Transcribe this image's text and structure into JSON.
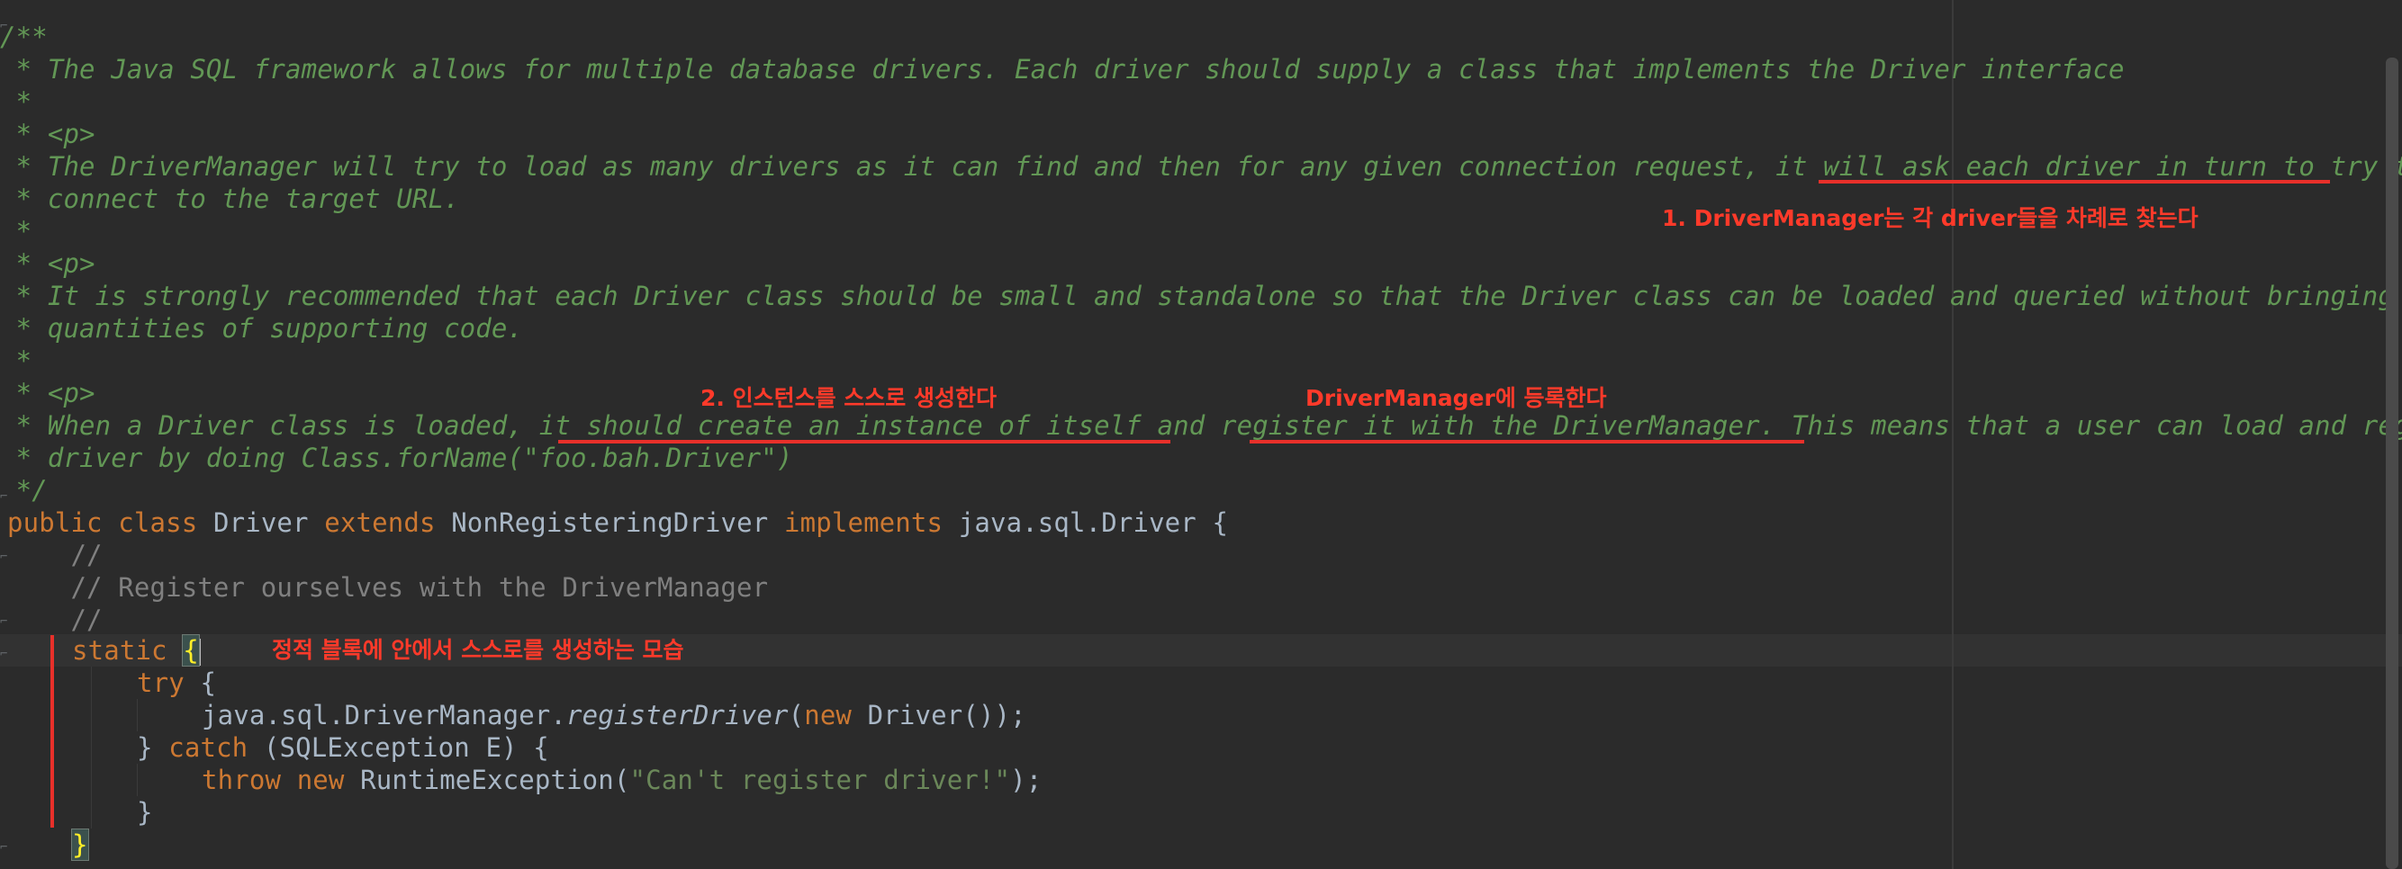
{
  "code": {
    "l1": "/**",
    "l2": " * The Java SQL framework allows for multiple database drivers. Each driver should supply a class that implements the Driver interface",
    "l3": " *",
    "l4": " * <p>",
    "l5a": " * The DriverManager will try to load as many drivers as it can find and then for any given connection request, ",
    "l5b": "it will ask each driver in turn",
    "l5c": " to try to",
    "l6": " * connect to the target URL.",
    "l7": " *",
    "l8": " * <p>",
    "l9": " * It is strongly recommended that each Driver class should be small and standalone so that the Driver class can be loaded and queried without bringing in vast",
    "l10": " * quantities of supporting code.",
    "l11": " *",
    "l12": " * <p>",
    "l13a": " * When a Driver class is loaded, ",
    "l13b": "it should create an instance of itself",
    "l13c": " and ",
    "l13d": "register it with the DriverManager",
    "l13e": ". This means that a user can load and register a",
    "l14a": " * driver by doing Class.forName(\"",
    "l14b": "foo.bah.Driver",
    "l14c": "\")",
    "l15": " */",
    "l16": {
      "k1": "public",
      "k2": "class",
      "name": "Driver",
      "k3": "extends",
      "parent": "NonRegisteringDriver",
      "k4": "implements",
      "iface": "java.sql.Driver {"
    },
    "l17": "    //",
    "l18": "    // Register ourselves with the DriverManager",
    "l19": "    //",
    "l20": {
      "kw": "static",
      "brace": "{"
    },
    "l21": {
      "kw": "try",
      "rest": " {"
    },
    "l22": {
      "a": "java.sql.DriverManager.",
      "b": "registerDriver",
      "c": "(",
      "kw": "new",
      "d": " Driver());"
    },
    "l23": {
      "a": "} ",
      "kw": "catch",
      "b": " (SQLException E) {"
    },
    "l24": {
      "kw1": "throw",
      "kw2": "new",
      "a": " RuntimeException(",
      "str": "\"Can't register driver!\"",
      "b": ");"
    },
    "l25": "}",
    "l26": "}"
  },
  "annotations": {
    "a1": "1. DriverManager는 각 driver들을 차례로 찾는다",
    "a2": "2. 인스턴스를 스스로 생성한다",
    "a3": "DriverManager에 등록한다",
    "a4": "정적 블록에 안에서 스스로를 생성하는 모습"
  },
  "colors": {
    "background": "#2b2b2b",
    "doc_comment": "#629755",
    "keyword": "#cc7832",
    "string": "#6a8759",
    "annotation_red": "#e8302a"
  }
}
